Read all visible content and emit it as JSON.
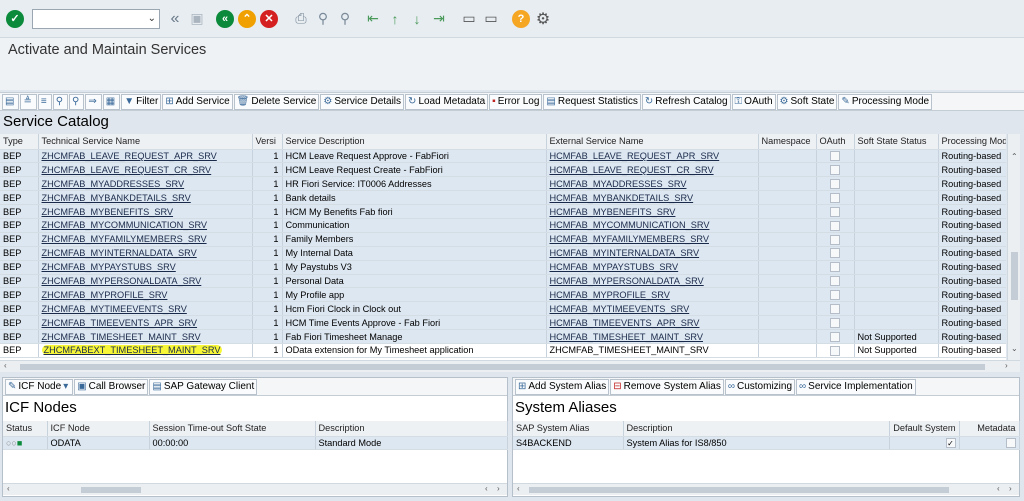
{
  "screen": {
    "title": "Activate and Maintain Services"
  },
  "toolbar": {
    "buttons": [
      {
        "label": "Filter"
      },
      {
        "label": "Add Service"
      },
      {
        "label": "Delete Service"
      },
      {
        "label": "Service Details"
      },
      {
        "label": "Load Metadata"
      },
      {
        "label": "Error Log"
      },
      {
        "label": "Request Statistics"
      },
      {
        "label": "Refresh Catalog"
      },
      {
        "label": "OAuth"
      },
      {
        "label": "Soft State"
      },
      {
        "label": "Processing Mode"
      }
    ]
  },
  "catalog": {
    "heading": "Service Catalog",
    "columns": [
      "Type",
      "Technical Service Name",
      "Versi",
      "Service Description",
      "External Service Name",
      "Namespace",
      "OAuth",
      "Soft State Status",
      "Processing Mod"
    ],
    "rows": [
      {
        "type": "BEP",
        "tech": "ZHCMFAB_LEAVE_REQUEST_APR_SRV",
        "ver": "1",
        "desc": "HCM Leave Request Approve - FabFiori",
        "ext": "HCMFAB_LEAVE_REQUEST_APR_SRV",
        "ns": "",
        "soft": "",
        "mode": "Routing-based"
      },
      {
        "type": "BEP",
        "tech": "ZHCMFAB_LEAVE_REQUEST_CR_SRV",
        "ver": "1",
        "desc": "HCM Leave Request Create - FabFiori",
        "ext": "HCMFAB_LEAVE_REQUEST_CR_SRV",
        "ns": "",
        "soft": "",
        "mode": "Routing-based"
      },
      {
        "type": "BEP",
        "tech": "ZHCMFAB_MYADDRESSES_SRV",
        "ver": "1",
        "desc": "HR Fiori Service: IT0006 Addresses",
        "ext": "HCMFAB_MYADDRESSES_SRV",
        "ns": "",
        "soft": "",
        "mode": "Routing-based"
      },
      {
        "type": "BEP",
        "tech": "ZHCMFAB_MYBANKDETAILS_SRV",
        "ver": "1",
        "desc": "Bank details",
        "ext": "HCMFAB_MYBANKDETAILS_SRV",
        "ns": "",
        "soft": "",
        "mode": "Routing-based"
      },
      {
        "type": "BEP",
        "tech": "ZHCMFAB_MYBENEFITS_SRV",
        "ver": "1",
        "desc": "HCM My Benefits Fab fiori",
        "ext": "HCMFAB_MYBENEFITS_SRV",
        "ns": "",
        "soft": "",
        "mode": "Routing-based"
      },
      {
        "type": "BEP",
        "tech": "ZHCMFAB_MYCOMMUNICATION_SRV",
        "ver": "1",
        "desc": "Communication",
        "ext": "HCMFAB_MYCOMMUNICATION_SRV",
        "ns": "",
        "soft": "",
        "mode": "Routing-based"
      },
      {
        "type": "BEP",
        "tech": "ZHCMFAB_MYFAMILYMEMBERS_SRV",
        "ver": "1",
        "desc": "Family Members",
        "ext": "HCMFAB_MYFAMILYMEMBERS_SRV",
        "ns": "",
        "soft": "",
        "mode": "Routing-based"
      },
      {
        "type": "BEP",
        "tech": "ZHCMFAB_MYINTERNALDATA_SRV",
        "ver": "1",
        "desc": "My Internal Data",
        "ext": "HCMFAB_MYINTERNALDATA_SRV",
        "ns": "",
        "soft": "",
        "mode": "Routing-based"
      },
      {
        "type": "BEP",
        "tech": "ZHCMFAB_MYPAYSTUBS_SRV",
        "ver": "1",
        "desc": "My Paystubs V3",
        "ext": "HCMFAB_MYPAYSTUBS_SRV",
        "ns": "",
        "soft": "",
        "mode": "Routing-based"
      },
      {
        "type": "BEP",
        "tech": "ZHCMFAB_MYPERSONALDATA_SRV",
        "ver": "1",
        "desc": "Personal Data",
        "ext": "HCMFAB_MYPERSONALDATA_SRV",
        "ns": "",
        "soft": "",
        "mode": "Routing-based"
      },
      {
        "type": "BEP",
        "tech": "ZHCMFAB_MYPROFILE_SRV",
        "ver": "1",
        "desc": "My Profile app",
        "ext": "HCMFAB_MYPROFILE_SRV",
        "ns": "",
        "soft": "",
        "mode": "Routing-based"
      },
      {
        "type": "BEP",
        "tech": "ZHCMFAB_MYTIMEEVENTS_SRV",
        "ver": "1",
        "desc": "Hcm Fiori Clock in Clock out",
        "ext": "HCMFAB_MYTIMEEVENTS_SRV",
        "ns": "",
        "soft": "",
        "mode": "Routing-based"
      },
      {
        "type": "BEP",
        "tech": "ZHCMFAB_TIMEEVENTS_APR_SRV",
        "ver": "1",
        "desc": "HCM Time Events Approve - Fab Fiori",
        "ext": "HCMFAB_TIMEEVENTS_APR_SRV",
        "ns": "",
        "soft": "",
        "mode": "Routing-based"
      },
      {
        "type": "BEP",
        "tech": "ZHCMFAB_TIMESHEET_MAINT_SRV",
        "ver": "1",
        "desc": "Fab Fiori Timesheet Manage",
        "ext": "HCMFAB_TIMESHEET_MAINT_SRV",
        "ns": "",
        "soft": "Not Supported",
        "mode": "Routing-based"
      },
      {
        "type": "BEP",
        "tech": "ZHCMFABEXT_TIMESHEET_MAINT_SRV",
        "ver": "1",
        "desc": "OData extension for My Timesheet application",
        "ext": "ZHCMFAB_TIMESHEET_MAINT_SRV",
        "ns": "",
        "soft": "Not Supported",
        "mode": "Routing-based"
      }
    ]
  },
  "icf_toolbar": [
    {
      "label": "ICF Node"
    },
    {
      "label": "Call Browser"
    },
    {
      "label": "SAP Gateway Client"
    }
  ],
  "icf": {
    "heading": "ICF Nodes",
    "columns": [
      "Status",
      "ICF Node",
      "Session Time-out Soft State",
      "Description"
    ],
    "rows": [
      {
        "node": "ODATA",
        "timeout": "00:00:00",
        "desc": "Standard Mode"
      }
    ]
  },
  "alias_toolbar": [
    {
      "label": "Add System Alias"
    },
    {
      "label": "Remove System Alias"
    },
    {
      "label": "Customizing"
    },
    {
      "label": "Service Implementation"
    }
  ],
  "aliases": {
    "heading": "System Aliases",
    "columns": [
      "SAP System Alias",
      "Description",
      "Default System",
      "Metadata"
    ],
    "rows": [
      {
        "alias": "S4BACKEND",
        "desc": "System Alias for IS8/850"
      }
    ]
  },
  "colors": {
    "accent_green": "#0a8a3a",
    "warn_orange": "#f0a000",
    "cancel_red": "#d42020",
    "help_orange": "#f5a623",
    "highlight": "#f7f738"
  }
}
